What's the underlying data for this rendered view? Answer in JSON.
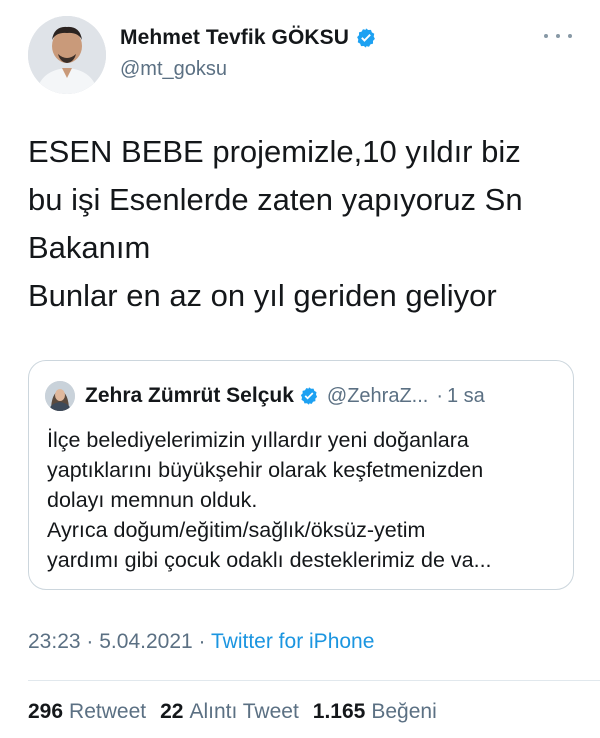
{
  "author": {
    "name": "Mehmet Tevfik GÖKSU",
    "handle": "@mt_goksu",
    "verified": true
  },
  "tweet": {
    "lines": [
      "ESEN BEBE projemizle,10 yıldır biz",
      "bu işi Esenlerde zaten yapıyoruz Sn",
      "Bakanım",
      "Bunlar en az on yıl geriden geliyor"
    ]
  },
  "quoted_tweet": {
    "name": "Zehra Zümrüt Selçuk",
    "handle": "@ZehraZ...",
    "separator": "·",
    "time": "1 sa",
    "lines": [
      "İlçe belediyelerimizin yıllardır yeni doğanlara",
      "yaptıklarını büyükşehir olarak keşfetmenizden",
      "dolayı memnun olduk.",
      "Ayrıca doğum/eğitim/sağlık/öksüz-yetim",
      "yardımı gibi çocuk odaklı desteklerimiz de va..."
    ]
  },
  "meta": {
    "time": "23:23",
    "dot1": "·",
    "date": "5.04.2021",
    "dot2": "·",
    "source": "Twitter for iPhone"
  },
  "stats": {
    "retweets_count": "296",
    "retweets_label": "Retweet",
    "quotes_count": "22",
    "quotes_label": "Alıntı Tweet",
    "likes_count": "1.165",
    "likes_label": "Beğeni"
  },
  "colors": {
    "verified": "#1da1f2",
    "link": "#1b95e0",
    "secondary_text": "#5b7083",
    "border": "#ccd6dd"
  },
  "icons": {
    "verified": "verified-badge-icon",
    "more": "more-options-icon"
  }
}
